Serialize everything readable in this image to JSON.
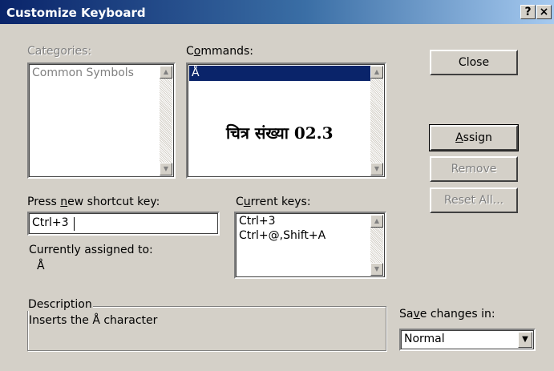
{
  "window": {
    "title": "Customize Keyboard",
    "help_label": "?",
    "close_label": "×"
  },
  "categories": {
    "label": "Categories:",
    "items": [
      "Common Symbols"
    ]
  },
  "commands": {
    "label_pre": "C",
    "label_underlined": "o",
    "label_post": "mmands:",
    "items": [
      "Å"
    ]
  },
  "caption": "चित्र संख्या 02.3",
  "shortcut": {
    "label_pre": "Press ",
    "label_underlined": "n",
    "label_post": "ew shortcut key:",
    "value": "Ctrl+3"
  },
  "current_keys": {
    "label_pre": "C",
    "label_underlined": "u",
    "label_post": "rrent keys:",
    "items": [
      "Ctrl+3",
      "Ctrl+@,Shift+A"
    ]
  },
  "assigned": {
    "label": "Currently assigned to:",
    "value": "Å"
  },
  "description": {
    "title": "Description",
    "text": "Inserts the Å character"
  },
  "save_in": {
    "label_pre": "Sa",
    "label_underlined": "v",
    "label_post": "e changes in:",
    "value": "Normal"
  },
  "buttons": {
    "close": "Close",
    "assign_pre": "",
    "assign_underlined": "A",
    "assign_post": "ssign",
    "remove": "Remove",
    "reset_all": "Reset All..."
  },
  "icons": {
    "scroll_up": "scroll-up-arrow-icon",
    "scroll_down": "scroll-down-arrow-icon",
    "dropdown": "dropdown-arrow-icon"
  }
}
